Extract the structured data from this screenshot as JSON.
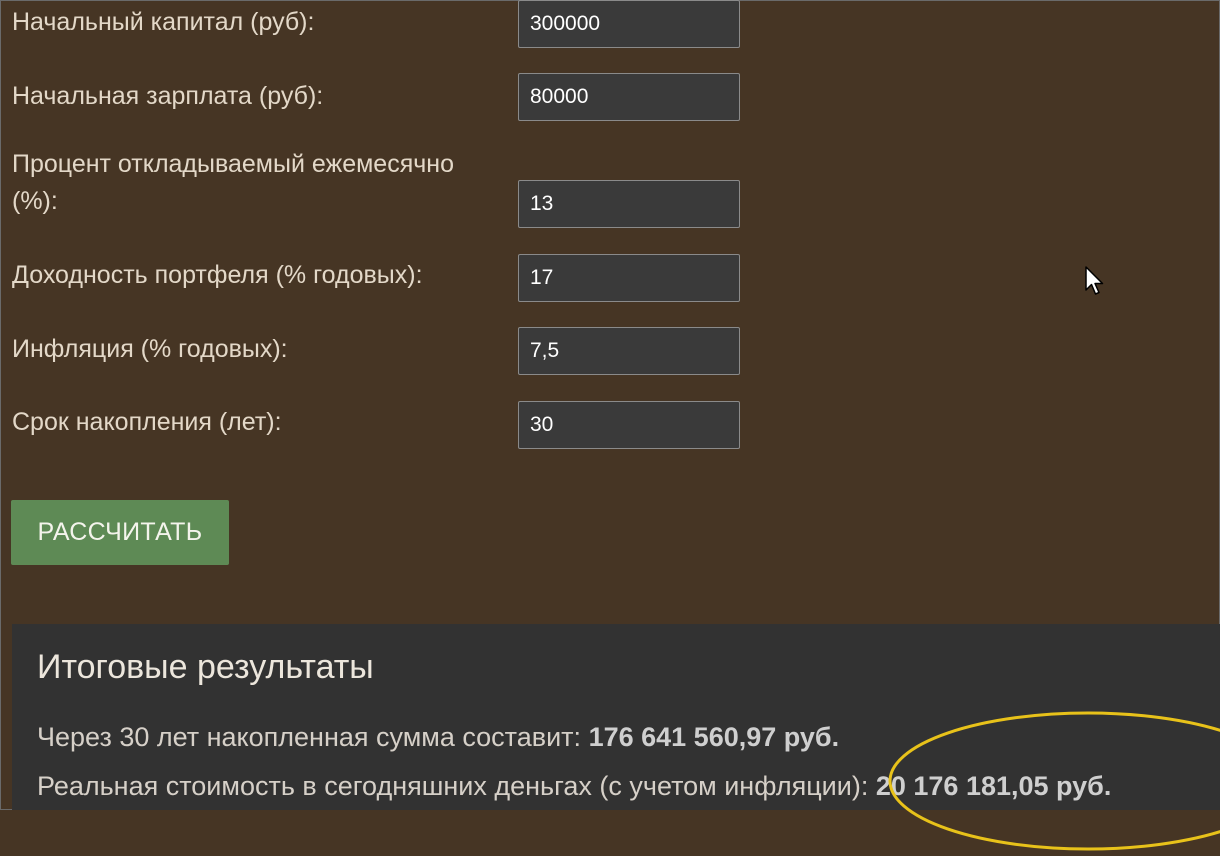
{
  "form": {
    "fields": [
      {
        "label": "Начальный капитал (руб):",
        "value": "300000"
      },
      {
        "label": "Начальная зарплата (руб):",
        "value": "80000"
      },
      {
        "label_line1": "Процент откладываемый ежемесячно",
        "label_line2": "(%):",
        "value": "13"
      },
      {
        "label": "Доходность портфеля (% годовых):",
        "value": "17"
      },
      {
        "label": "Инфляция (% годовых):",
        "value": "7,5"
      },
      {
        "label": "Срок накопления (лет):",
        "value": "30"
      }
    ],
    "calculate_label": "РАССЧИТАТЬ"
  },
  "results": {
    "title": "Итоговые результаты",
    "line1_prefix": "Через 30 лет накопленная сумма составит:",
    "line1_value": "176 641 560,97 руб.",
    "line2_prefix": "Реальная стоимость в сегодняшних деньгах (с учетом инфляции):",
    "line2_value": "20 176 181,05 руб."
  },
  "colors": {
    "background": "#463524",
    "button": "#5e8a55",
    "results_panel": "#323232",
    "highlight_ellipse": "#e8c21a"
  }
}
